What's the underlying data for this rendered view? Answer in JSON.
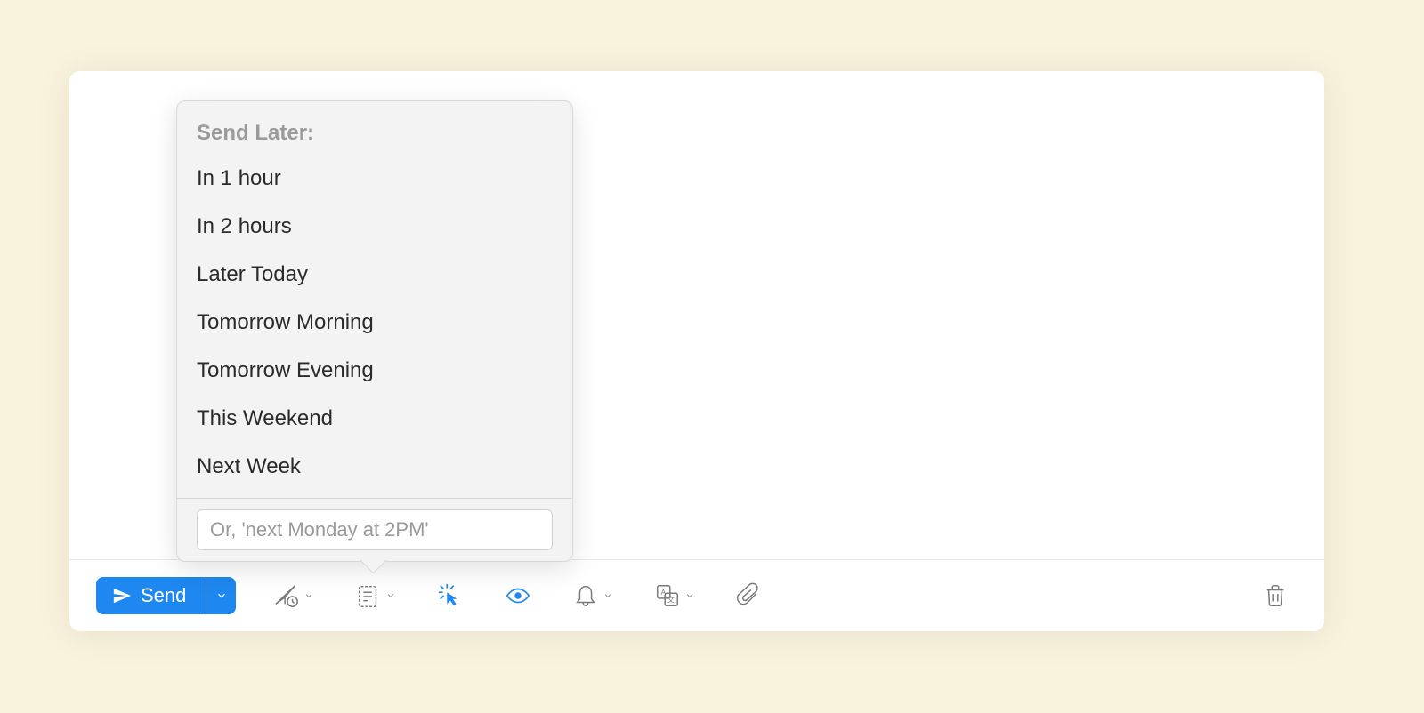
{
  "toolbar": {
    "send_label": "Send"
  },
  "popover": {
    "title": "Send Later:",
    "items": [
      "In 1 hour",
      "In 2 hours",
      "Later Today",
      "Tomorrow Morning",
      "Tomorrow Evening",
      "This Weekend",
      "Next Week"
    ],
    "custom_placeholder": "Or, 'next Monday at 2PM'"
  },
  "colors": {
    "accent": "#1e88f0",
    "background": "#f9f3dd",
    "popover_bg": "#f3f3f3",
    "icon_gray": "#7a7a7a"
  }
}
